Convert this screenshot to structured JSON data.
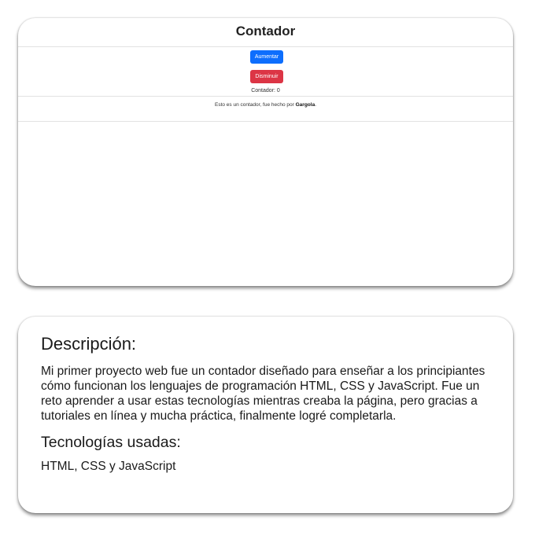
{
  "preview": {
    "title": "Contador",
    "increase_label": "Aumentar",
    "decrease_label": "Disminuir",
    "counter_label": "Contador:",
    "counter_value": "0",
    "footer_prefix": "Esto es un contador, fue hecho por",
    "footer_author": "Gargola",
    "footer_suffix": "."
  },
  "description": {
    "heading": "Descripción:",
    "text": "Mi primer proyecto web fue un contador diseñado para enseñar a los principiantes cómo funcionan los lenguajes de programación HTML, CSS y JavaScript. Fue un reto aprender a usar estas tecnologías mientras creaba la página, pero gracias a tutoriales en línea y mucha práctica, finalmente logré completarla.",
    "tech_heading": "Tecnologías usadas:",
    "tech_text": "HTML, CSS y JavaScript"
  },
  "colors": {
    "increase_button": "#0d6efd",
    "decrease_button": "#dc3545"
  }
}
